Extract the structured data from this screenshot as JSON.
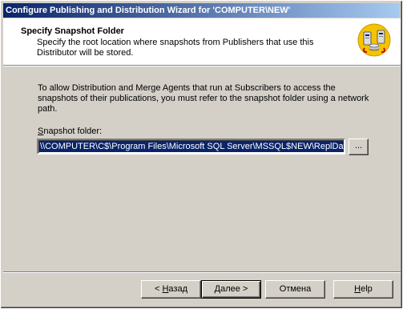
{
  "window": {
    "title": "Configure Publishing and Distribution Wizard for 'COMPUTER\\NEW'"
  },
  "header": {
    "title": "Specify Snapshot Folder",
    "description": "Specify the root location where snapshots from Publishers that use this Distributor will be stored.",
    "icon": "server-disk-icon"
  },
  "main": {
    "body_text": "To allow Distribution and Merge Agents that run at Subscribers to access the snapshots of their publications, you must refer to the snapshot folder using a network path.",
    "snapshot_label_mnemonic": "S",
    "snapshot_label_rest": "napshot folder:",
    "snapshot_value": "\\\\COMPUTER\\C$\\Program Files\\Microsoft SQL Server\\MSSQL$NEW\\ReplData",
    "browse_label": "..."
  },
  "footer": {
    "back_prefix": "< ",
    "back_mnemonic": "Н",
    "back_rest": "азад",
    "next_label_main": "Далее",
    "next_suffix": " >",
    "cancel_label": "Отмена",
    "help_mnemonic": "H",
    "help_rest": "elp"
  },
  "colors": {
    "title_gradient_start": "#0a246a",
    "title_gradient_end": "#a6caf0",
    "selection": "#0a246a",
    "face": "#d4d0c8"
  }
}
